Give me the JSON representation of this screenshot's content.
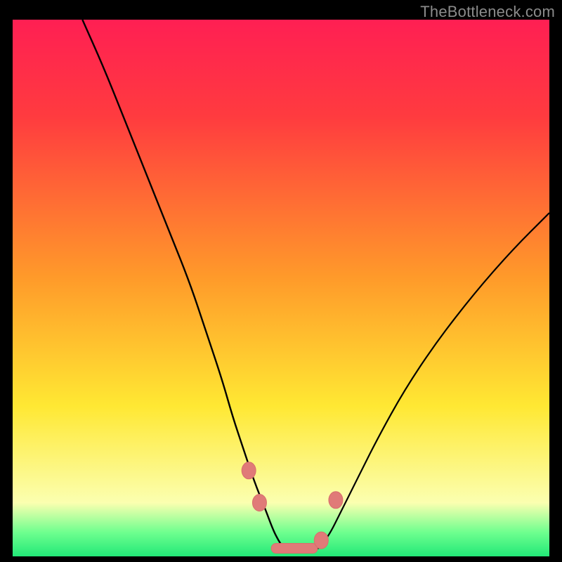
{
  "watermark": {
    "text": "TheBottleneck.com"
  },
  "colors": {
    "black": "#000000",
    "curve": "#000000",
    "marker_fill": "#e07a78",
    "marker_stroke": "#d86e6b",
    "grad_top": "#ff1f53",
    "grad_red": "#ff3b3f",
    "grad_orange": "#ff9a2a",
    "grad_yellow": "#ffe833",
    "grad_pale": "#fbffb0",
    "grad_green_light": "#6fff8f",
    "grad_green": "#22e877"
  },
  "chart_data": {
    "type": "line",
    "title": "",
    "xlabel": "",
    "ylabel": "",
    "xlim": [
      0,
      100
    ],
    "ylim": [
      0,
      100
    ],
    "series": [
      {
        "name": "left-curve",
        "x": [
          13,
          17,
          21,
          25,
          29,
          33,
          36,
          39,
          41,
          43,
          45,
          47,
          48.5,
          49.5,
          50.5
        ],
        "y": [
          100,
          91,
          81,
          71,
          61,
          51,
          42,
          33,
          26,
          20,
          14,
          9,
          5,
          3,
          1.5
        ]
      },
      {
        "name": "right-curve",
        "x": [
          57,
          59,
          61,
          64,
          68,
          73,
          79,
          86,
          93,
          100
        ],
        "y": [
          1.5,
          4,
          8,
          14,
          22,
          31,
          40,
          49,
          57,
          64
        ]
      }
    ],
    "flat_region": {
      "x_start": 50.5,
      "x_end": 57,
      "y": 1.5
    },
    "markers": [
      {
        "name": "pt-left-upper",
        "x": 44.0,
        "y": 16,
        "shape": "round"
      },
      {
        "name": "pt-left-lower",
        "x": 46.0,
        "y": 10,
        "shape": "round"
      },
      {
        "name": "pt-flat-track",
        "x": 52.5,
        "y": 1.5,
        "shape": "track"
      },
      {
        "name": "pt-right-lower",
        "x": 57.5,
        "y": 3,
        "shape": "round"
      },
      {
        "name": "pt-right-upper",
        "x": 60.2,
        "y": 10.5,
        "shape": "round"
      }
    ],
    "gradient_stops": [
      {
        "offset": 0,
        "color_key": "grad_top"
      },
      {
        "offset": 0.18,
        "color_key": "grad_red"
      },
      {
        "offset": 0.48,
        "color_key": "grad_orange"
      },
      {
        "offset": 0.72,
        "color_key": "grad_yellow"
      },
      {
        "offset": 0.9,
        "color_key": "grad_pale"
      },
      {
        "offset": 0.955,
        "color_key": "grad_green_light"
      },
      {
        "offset": 1.0,
        "color_key": "grad_green"
      }
    ]
  }
}
